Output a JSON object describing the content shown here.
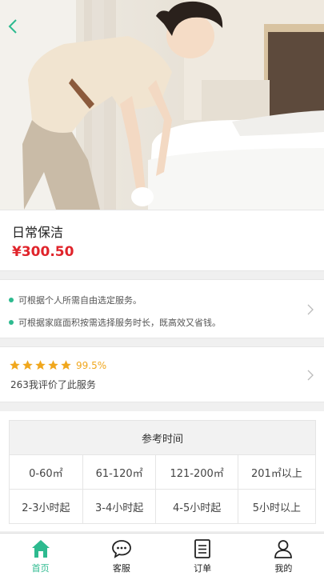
{
  "hero": {
    "photo_icon": "cleaning-woman-photo",
    "back_icon": "chevron-left-icon"
  },
  "service": {
    "title": "日常保洁",
    "price": "¥300.50"
  },
  "features": [
    "可根据个人所需自由选定服务。",
    "可根据家庭面积按需选择服务时长，既高效又省钱。"
  ],
  "rating": {
    "stars": 5,
    "percent": "99.5%",
    "text": "263我评价了此服务"
  },
  "time_table": {
    "header": "参考时间",
    "areas": [
      "0-60㎡",
      "61-120㎡",
      "121-200㎡",
      "201㎡以上"
    ],
    "durations": [
      "2-3小时起",
      "3-4小时起",
      "4-5小时起",
      "5小时以上"
    ]
  },
  "tabbar": {
    "active": "home",
    "items": [
      {
        "label": "首页",
        "icon": "home-icon"
      },
      {
        "label": "客服",
        "icon": "chat-icon"
      },
      {
        "label": "订单",
        "icon": "order-list-icon"
      },
      {
        "label": "我的",
        "icon": "user-icon"
      }
    ]
  },
  "colors": {
    "accent": "#2dba8f",
    "price": "#e0242b",
    "star": "#f0a71d"
  }
}
